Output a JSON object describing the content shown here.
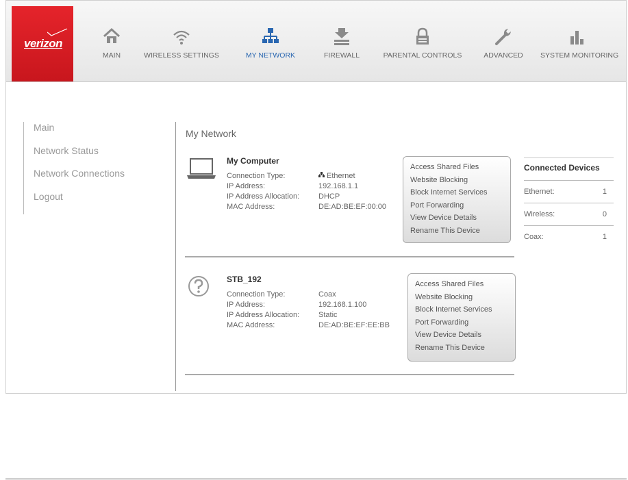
{
  "brand": {
    "logo_text": "verizon"
  },
  "nav": [
    {
      "label": "MAIN",
      "icon": "home-icon"
    },
    {
      "label": "WIRELESS SETTINGS",
      "icon": "wifi-icon"
    },
    {
      "label": "MY NETWORK",
      "icon": "network-icon",
      "active": true
    },
    {
      "label": "FIREWALL",
      "icon": "firewall-icon"
    },
    {
      "label": "PARENTAL CONTROLS",
      "icon": "lock-icon"
    },
    {
      "label": "ADVANCED",
      "icon": "wrench-icon"
    },
    {
      "label": "SYSTEM MONITORING",
      "icon": "bar-chart-icon"
    }
  ],
  "sidebar": {
    "items": [
      {
        "label": "Main"
      },
      {
        "label": "Network Status"
      },
      {
        "label": "Network Connections"
      },
      {
        "label": "Logout"
      }
    ]
  },
  "main": {
    "title": "My Network",
    "devices": [
      {
        "name": "My Computer",
        "icon": "laptop-icon",
        "fields": [
          {
            "key": "Connection Type:",
            "value": "Ethernet",
            "value_icon": "ethernet-icon"
          },
          {
            "key": "IP Address:",
            "value": "192.168.1.1"
          },
          {
            "key": "IP Address Allocation:",
            "value": "DHCP"
          },
          {
            "key": "MAC Address:",
            "value": "DE:AD:BE:EF:00:00"
          }
        ],
        "actions": [
          "Access Shared Files",
          "Website Blocking",
          "Block Internet Services",
          "Port Forwarding",
          "View Device Details",
          "Rename This Device"
        ]
      },
      {
        "name": "STB_192",
        "icon": "unknown-device-icon",
        "fields": [
          {
            "key": "Connection Type:",
            "value": "Coax"
          },
          {
            "key": "IP Address:",
            "value": "192.168.1.100"
          },
          {
            "key": "IP Address Allocation:",
            "value": "Static"
          },
          {
            "key": "MAC Address:",
            "value": "DE:AD:BE:EF:EE:BB"
          }
        ],
        "actions": [
          "Access Shared Files",
          "Website Blocking",
          "Block Internet Services",
          "Port Forwarding",
          "View Device Details",
          "Rename This Device"
        ]
      }
    ]
  },
  "connected_devices": {
    "title": "Connected Devices",
    "rows": [
      {
        "label": "Ethernet:",
        "count": "1"
      },
      {
        "label": "Wireless:",
        "count": "0"
      },
      {
        "label": "Coax:",
        "count": "1"
      }
    ]
  },
  "colors": {
    "brand_red": "#d61f26",
    "active_nav": "#2a67b1",
    "nav_icon": "#8a8a8a"
  }
}
